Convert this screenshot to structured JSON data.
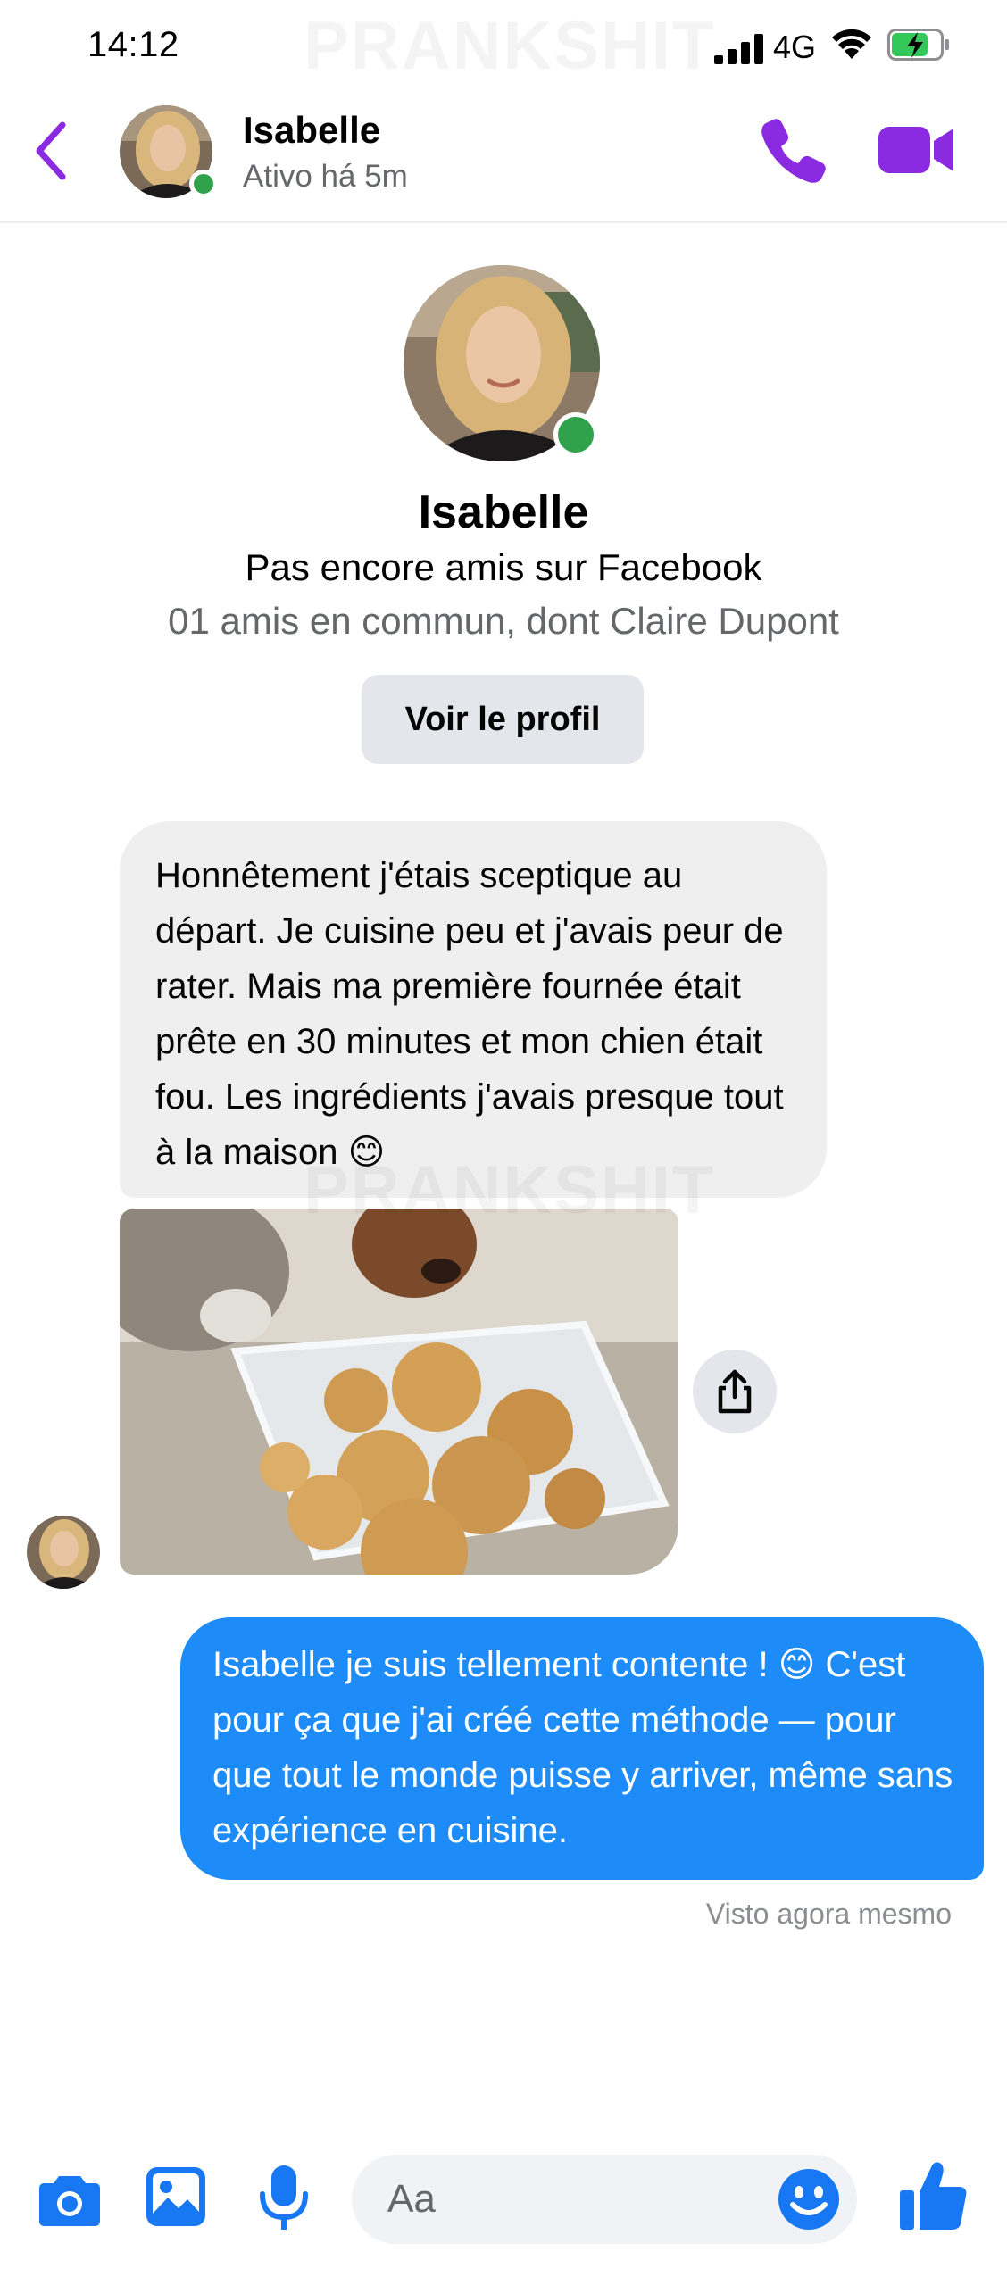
{
  "status_bar": {
    "time": "14:12",
    "network": "4G",
    "watermark": "PRANKSHIT"
  },
  "header": {
    "contact_name": "Isabelle",
    "active_status": "Ativo há 5m",
    "accent_color": "#8a2be2"
  },
  "profile_intro": {
    "name": "Isabelle",
    "friend_status": "Pas encore amis sur Facebook",
    "mutual_friends": "01 amis en commun, dont Claire Dupont",
    "view_profile_label": "Voir le profil"
  },
  "messages": {
    "incoming_text": "Honnêtement j'étais sceptique au départ. Je cuisine peu et j'avais peur de rater. Mais ma première fournée était prête en 30 minutes et mon chien était fou. Les ingrédients j'avais presque tout à la maison 😊",
    "outgoing_text": "Isabelle je suis tellement contente ! 😊 C'est pour ça que j'ai créé cette méthode — pour que tout le monde puisse y arriver, même sans expérience en cuisine.",
    "seen_label": "Visto agora mesmo",
    "incoming_bg": "#efefef",
    "outgoing_bg": "#1d8cf8"
  },
  "composer": {
    "placeholder": "Aa",
    "icon_color": "#1877f2"
  }
}
